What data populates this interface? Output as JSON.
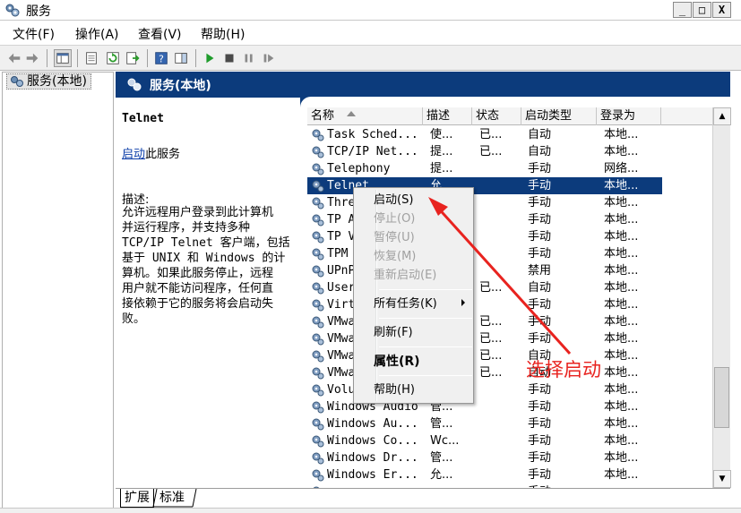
{
  "window": {
    "title": "服务",
    "minimize": "_",
    "maximize": "□",
    "close": "X"
  },
  "menu": [
    "文件(F)",
    "操作(A)",
    "查看(V)",
    "帮助(H)"
  ],
  "tree": {
    "item": "服务(本地)"
  },
  "header": {
    "title": "服务(本地)"
  },
  "description": {
    "service_name": "Telnet",
    "start_link": "启动",
    "start_suffix": "此服务",
    "label": "描述:",
    "lines": [
      "允许远程用户登录到此计算机",
      "并运行程序，并支持多种",
      "TCP/IP Telnet 客户端，包括",
      "基于 UNIX 和 Windows 的计",
      "算机。如果此服务停止，远程",
      "用户就不能访问程序，任何直",
      "接依赖于它的服务将会启动失",
      "败。"
    ]
  },
  "columns": [
    "名称",
    "描述",
    "状态",
    "启动类型",
    "登录为"
  ],
  "rows": [
    {
      "name": "Task Sched...",
      "desc": "使...",
      "status": "已...",
      "start": "自动",
      "logon": "本地..."
    },
    {
      "name": "TCP/IP Net...",
      "desc": "提...",
      "status": "已...",
      "start": "自动",
      "logon": "本地..."
    },
    {
      "name": "Telephony",
      "desc": "提...",
      "status": "",
      "start": "手动",
      "logon": "网络..."
    },
    {
      "name": "Telnet",
      "desc": "允",
      "status": "",
      "start": "手动",
      "logon": "本地..."
    },
    {
      "name": "Thre",
      "desc": "",
      "status": "",
      "start": "手动",
      "logon": "本地..."
    },
    {
      "name": "TP A",
      "desc": "",
      "status": "",
      "start": "手动",
      "logon": "本地..."
    },
    {
      "name": "TP V",
      "desc": "",
      "status": "",
      "start": "手动",
      "logon": "本地..."
    },
    {
      "name": "TPM",
      "desc": "",
      "status": "",
      "start": "手动",
      "logon": "本地..."
    },
    {
      "name": "UPnP",
      "desc": "",
      "status": "",
      "start": "禁用",
      "logon": "本地..."
    },
    {
      "name": "User",
      "desc": "",
      "status": "已...",
      "start": "自动",
      "logon": "本地..."
    },
    {
      "name": "Virt",
      "desc": "",
      "status": "",
      "start": "手动",
      "logon": "本地..."
    },
    {
      "name": "VMwa",
      "desc": "",
      "status": "已...",
      "start": "手动",
      "logon": "本地..."
    },
    {
      "name": "VMwa",
      "desc": "",
      "status": "已...",
      "start": "手动",
      "logon": "本地..."
    },
    {
      "name": "VMwa",
      "desc": "",
      "status": "已...",
      "start": "自动",
      "logon": "本地..."
    },
    {
      "name": "VMwa",
      "desc": "",
      "status": "已...",
      "start": "自动",
      "logon": "本地..."
    },
    {
      "name": "Volu",
      "desc": "",
      "status": "",
      "start": "手动",
      "logon": "本地..."
    },
    {
      "name": "Windows Audio",
      "desc": "管...",
      "status": "",
      "start": "手动",
      "logon": "本地..."
    },
    {
      "name": "Windows Au...",
      "desc": "管...",
      "status": "",
      "start": "手动",
      "logon": "本地..."
    },
    {
      "name": "Windows Co...",
      "desc": "Wc...",
      "status": "",
      "start": "手动",
      "logon": "本地..."
    },
    {
      "name": "Windows Dr...",
      "desc": "管...",
      "status": "",
      "start": "手动",
      "logon": "本地..."
    },
    {
      "name": "Windows Er...",
      "desc": "允...",
      "status": "",
      "start": "手动",
      "logon": "本地..."
    },
    {
      "name": "",
      "desc": "",
      "status": "",
      "start": "手动",
      "logon": ""
    }
  ],
  "selected_row": 3,
  "context_menu": {
    "start": "启动(S)",
    "stop": "停止(O)",
    "pause": "暂停(U)",
    "resume": "恢复(M)",
    "restart": "重新启动(E)",
    "all_tasks": "所有任务(K)",
    "refresh": "刷新(F)",
    "properties": "属性(R)",
    "help": "帮助(H)"
  },
  "tabs": {
    "extended": "扩展",
    "standard": "标准"
  },
  "annotation": {
    "text": "选择启动",
    "color": "#e8231f"
  },
  "colors": {
    "header_blue": "#0c3b7c",
    "link": "#0b3da8"
  }
}
